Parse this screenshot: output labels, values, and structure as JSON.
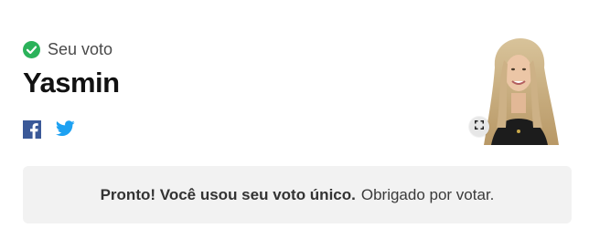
{
  "vote": {
    "status_label": "Seu voto",
    "candidate_name": "Yasmin"
  },
  "share": {
    "facebook_icon": "facebook-icon",
    "twitter_icon": "twitter-icon"
  },
  "photo": {
    "expand_icon": "expand-icon"
  },
  "message": {
    "strong_text": "Pronto! Você usou seu voto único.",
    "rest_text": "Obrigado por votar."
  },
  "colors": {
    "check_green": "#2bb25a",
    "facebook_blue": "#3b5998",
    "twitter_blue": "#1da1f2",
    "message_bg": "#f2f2f2"
  }
}
